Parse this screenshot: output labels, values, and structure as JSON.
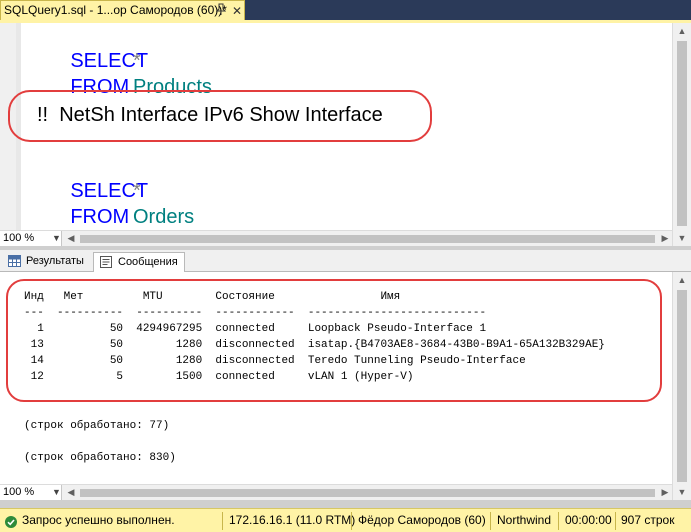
{
  "tab": {
    "title": "SQLQuery1.sql - 1...ор Самородов (60))*",
    "pin_icon": "pin-icon",
    "close_icon": "close-icon"
  },
  "editor": {
    "lines": [
      {
        "kw": "SELECT",
        "rest": "*"
      },
      {
        "kw": "FROM",
        "rest": "Products"
      },
      {
        "text": "!!  NetSh Interface IPv6 Show Interface"
      },
      {
        "kw": "SELECT",
        "rest": "*"
      },
      {
        "kw": "FROM",
        "rest": "Orders"
      }
    ],
    "zoom": "100 %"
  },
  "results": {
    "tabs": [
      {
        "label": "Результаты",
        "icon": "grid-icon"
      },
      {
        "label": "Сообщения",
        "icon": "messages-icon"
      }
    ],
    "header": "Инд   Мет         MTU        Состояние                Имя",
    "separator": "---  ----------  ----------  ------------  ---------------------------",
    "rows": [
      "  1          50  4294967295  connected     Loopback Pseudo-Interface 1",
      " 13          50        1280  disconnected  isatap.{B4703AE8-3684-43B0-B9A1-65A132B329AE}",
      " 14          50        1280  disconnected  Teredo Tunneling Pseudo-Interface",
      " 12           5        1500  connected     vLAN 1 (Hyper-V)"
    ],
    "row_count_1": "(строк обработано: 77)",
    "row_count_2": "(строк обработано: 830)",
    "zoom": "100 %"
  },
  "status": {
    "message": "Запрос успешно выполнен.",
    "server": "172.16.16.1 (11.0 RTM)",
    "user": "Фёдор Самородов (60)",
    "database": "Northwind",
    "elapsed": "00:00:00",
    "rows": "907 строк",
    "ok_icon": "check-circle-icon"
  },
  "colors": {
    "keyword": "#0000ff",
    "identifier": "#008080",
    "highlight": "#e23d3d",
    "status_bar": "#fff3a6"
  }
}
